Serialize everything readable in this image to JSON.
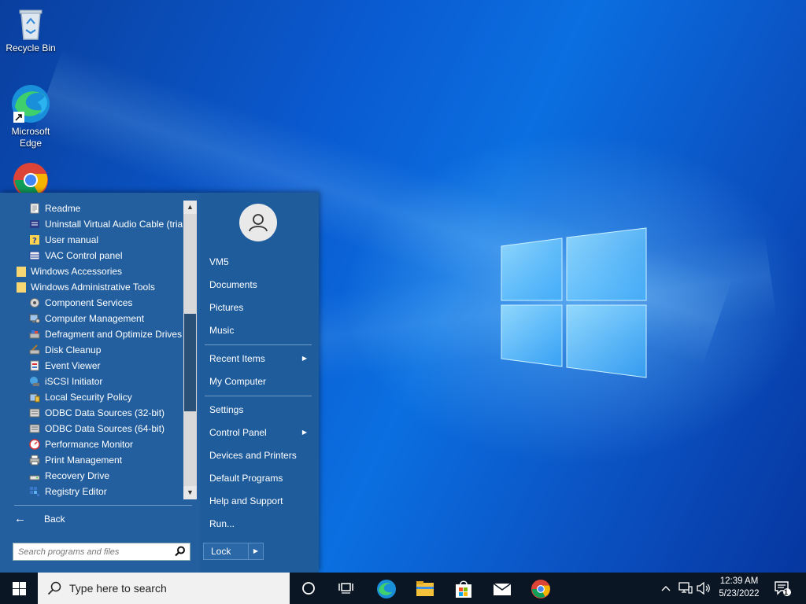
{
  "desktop": {
    "icons": [
      {
        "label": "Recycle Bin",
        "icon": "recycle-bin-icon"
      },
      {
        "label": "Microsoft Edge",
        "label_line1": "Microsoft",
        "label_line2": "Edge",
        "icon": "edge-icon"
      },
      {
        "label": "",
        "icon": "chrome-icon"
      }
    ]
  },
  "start_menu": {
    "programs": [
      {
        "label": "Readme",
        "icon": "document-icon",
        "kind": "sub"
      },
      {
        "label": "Uninstall Virtual Audio Cable (trial)",
        "icon": "uninstall-icon",
        "kind": "sub"
      },
      {
        "label": "User manual",
        "icon": "help-icon",
        "kind": "sub"
      },
      {
        "label": "VAC Control panel",
        "icon": "vac-icon",
        "kind": "sub"
      },
      {
        "label": "Windows Accessories",
        "icon": "folder-icon",
        "kind": "folder"
      },
      {
        "label": "Windows Administrative Tools",
        "icon": "folder-icon",
        "kind": "folder"
      },
      {
        "label": "Component Services",
        "icon": "component-services-icon",
        "kind": "sub"
      },
      {
        "label": "Computer Management",
        "icon": "computer-management-icon",
        "kind": "sub"
      },
      {
        "label": "Defragment and Optimize Drives",
        "icon": "defrag-icon",
        "kind": "sub"
      },
      {
        "label": "Disk Cleanup",
        "icon": "disk-cleanup-icon",
        "kind": "sub"
      },
      {
        "label": "Event Viewer",
        "icon": "event-viewer-icon",
        "kind": "sub"
      },
      {
        "label": "iSCSI Initiator",
        "icon": "iscsi-icon",
        "kind": "sub"
      },
      {
        "label": "Local Security Policy",
        "icon": "security-policy-icon",
        "kind": "sub"
      },
      {
        "label": "ODBC Data Sources (32-bit)",
        "icon": "odbc-icon",
        "kind": "sub"
      },
      {
        "label": "ODBC Data Sources (64-bit)",
        "icon": "odbc-icon",
        "kind": "sub"
      },
      {
        "label": "Performance Monitor",
        "icon": "performance-monitor-icon",
        "kind": "sub"
      },
      {
        "label": "Print Management",
        "icon": "print-management-icon",
        "kind": "sub"
      },
      {
        "label": "Recovery Drive",
        "icon": "recovery-drive-icon",
        "kind": "sub"
      },
      {
        "label": "Registry Editor",
        "icon": "registry-editor-icon",
        "kind": "sub"
      }
    ],
    "back_label": "Back",
    "search_placeholder": "Search programs and files",
    "right": {
      "user_name": "VM5",
      "group1": [
        "Documents",
        "Pictures",
        "Music"
      ],
      "recent_items": "Recent Items",
      "my_computer": "My Computer",
      "settings": "Settings",
      "control_panel": "Control Panel",
      "devices_printers": "Devices and Printers",
      "default_programs": "Default Programs",
      "help_support": "Help and Support",
      "run": "Run..."
    },
    "lock_label": "Lock"
  },
  "taskbar": {
    "search_placeholder": "Type here to search",
    "apps": [
      "cortana-icon",
      "task-view-icon",
      "edge-icon",
      "file-explorer-icon",
      "store-icon",
      "mail-icon",
      "chrome-icon"
    ],
    "clock": {
      "time": "12:39 AM",
      "date": "5/23/2022"
    },
    "notification_count": "1"
  },
  "colors": {
    "start_menu_bg": "#1f5c9c",
    "programs_bg": "#235f9f",
    "taskbar_bg": "#0b1625",
    "desktop_blue": "#0b6fe0"
  }
}
